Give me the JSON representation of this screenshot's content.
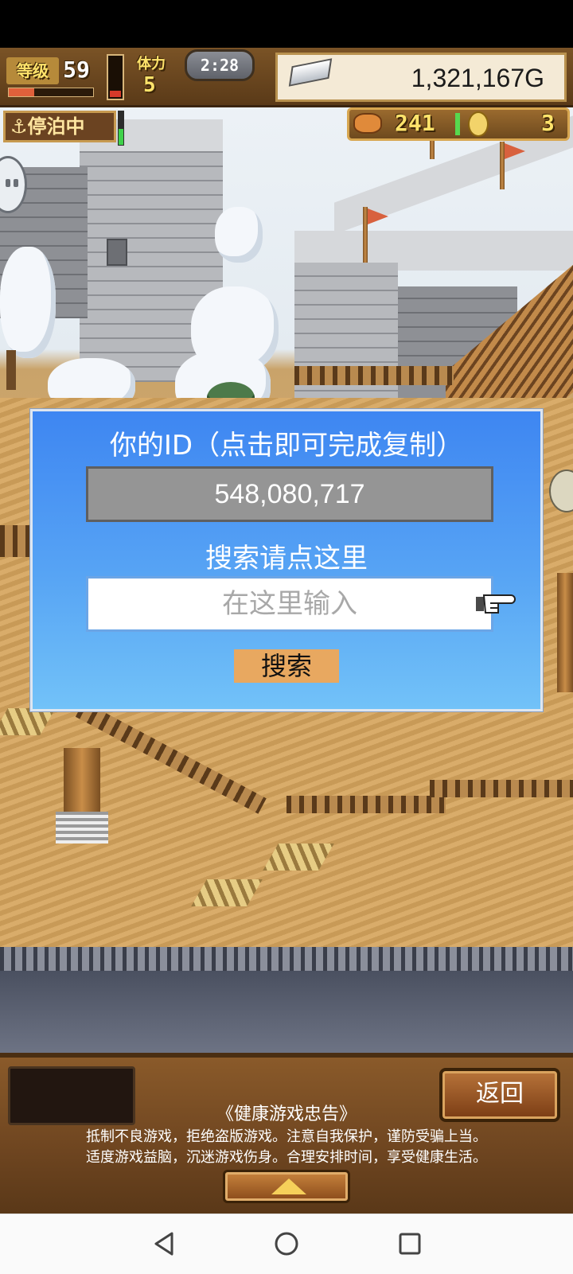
{
  "hud": {
    "level_label": "等级",
    "level_value": "59",
    "level_progress": 0.3,
    "stamina_label": "体力",
    "stamina_value": "5",
    "stamina_fill": 0.15,
    "timer": "2:28",
    "gold": "1,321,167G",
    "anchor_status": "⚓停泊中",
    "anchor_fill": 0.45,
    "food": "241",
    "coins": "3"
  },
  "dialog": {
    "title": "你的ID（点击即可完成复制）",
    "player_id": "548,080,717",
    "search_hint": "搜索请点这里",
    "search_placeholder": "在这里输入",
    "search_value": "",
    "search_button": "搜索"
  },
  "bottom": {
    "back_button": "返回",
    "notice_title": "《健康游戏忠告》",
    "notice_line1": "抵制不良游戏，拒绝盗版游戏。注意自我保护，谨防受骗上当。",
    "notice_line2": "适度游戏益脑，沉迷游戏伤身。合理安排时间，享受健康生活。"
  },
  "icons": {
    "gold": "silver-bar-icon",
    "food": "fish-icon",
    "coin": "medal-icon",
    "hand": "pointing-hand-icon",
    "chat": "chat-bubble-icon"
  },
  "colors": {
    "dialog_top": "#3e86f2",
    "dialog_bottom": "#72c2f8",
    "search_button": "#e8a860",
    "hud_text": "#ffe36b"
  }
}
